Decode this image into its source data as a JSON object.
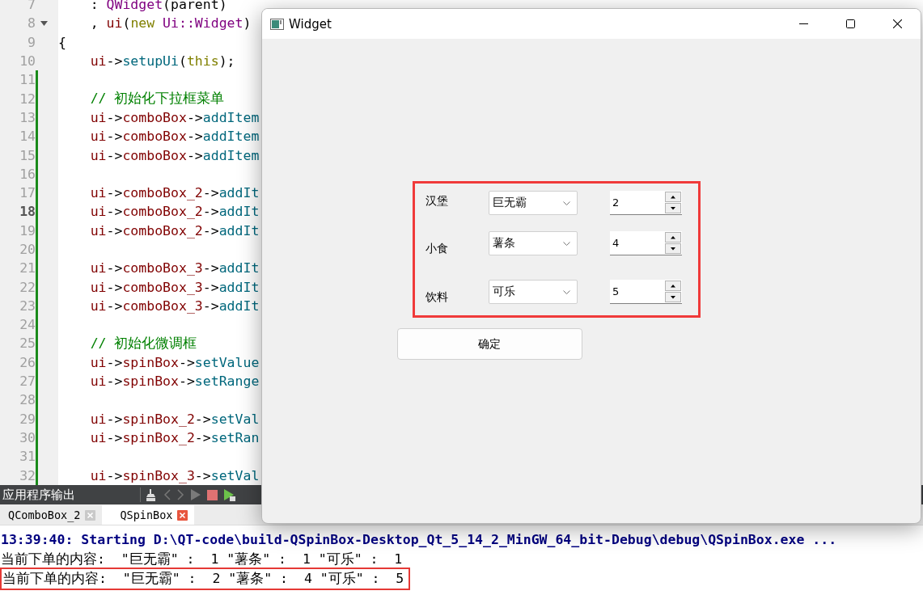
{
  "editor": {
    "lines": [
      {
        "number": "7",
        "indented": true,
        "changed": false,
        "current": false,
        "fold": false,
        "tokens": [
          {
            "kind": "plain",
            "text": ": "
          },
          {
            "kind": "type",
            "text": "QWidget"
          },
          {
            "kind": "plain",
            "text": "(parent)"
          }
        ]
      },
      {
        "number": "8",
        "indented": true,
        "changed": false,
        "current": false,
        "fold": true,
        "tokens": [
          {
            "kind": "plain",
            "text": ", "
          },
          {
            "kind": "member",
            "text": "ui"
          },
          {
            "kind": "plain",
            "text": "("
          },
          {
            "kind": "keyword",
            "text": "new"
          },
          {
            "kind": "type",
            "text": " Ui::Widget"
          },
          {
            "kind": "plain",
            "text": ")"
          }
        ]
      },
      {
        "number": "9",
        "indented": false,
        "changed": false,
        "current": false,
        "fold": false,
        "tokens": [
          {
            "kind": "plain",
            "text": "{"
          }
        ]
      },
      {
        "number": "10",
        "indented": true,
        "changed": false,
        "current": false,
        "fold": false,
        "tokens": [
          {
            "kind": "member",
            "text": "ui"
          },
          {
            "kind": "plain",
            "text": "->"
          },
          {
            "kind": "func",
            "text": "setupUi"
          },
          {
            "kind": "plain",
            "text": "("
          },
          {
            "kind": "keyword",
            "text": "this"
          },
          {
            "kind": "plain",
            "text": ");"
          }
        ]
      },
      {
        "number": "11",
        "changed": true,
        "current": false,
        "fold": false
      },
      {
        "number": "12",
        "indented": true,
        "changed": true,
        "current": false,
        "fold": false,
        "tokens": [
          {
            "kind": "comment",
            "text": "// 初始化下拉框菜单"
          }
        ]
      },
      {
        "number": "13",
        "indented": true,
        "changed": true,
        "current": false,
        "fold": false,
        "tokens": [
          {
            "kind": "member",
            "text": "ui"
          },
          {
            "kind": "plain",
            "text": "->"
          },
          {
            "kind": "member",
            "text": "comboBox"
          },
          {
            "kind": "plain",
            "text": "->"
          },
          {
            "kind": "func",
            "text": "addItem"
          }
        ]
      },
      {
        "number": "14",
        "indented": true,
        "changed": true,
        "current": false,
        "fold": false,
        "tokens": [
          {
            "kind": "member",
            "text": "ui"
          },
          {
            "kind": "plain",
            "text": "->"
          },
          {
            "kind": "member",
            "text": "comboBox"
          },
          {
            "kind": "plain",
            "text": "->"
          },
          {
            "kind": "func",
            "text": "addItem"
          }
        ]
      },
      {
        "number": "15",
        "indented": true,
        "changed": true,
        "current": false,
        "fold": false,
        "tokens": [
          {
            "kind": "member",
            "text": "ui"
          },
          {
            "kind": "plain",
            "text": "->"
          },
          {
            "kind": "member",
            "text": "comboBox"
          },
          {
            "kind": "plain",
            "text": "->"
          },
          {
            "kind": "func",
            "text": "addItem"
          }
        ]
      },
      {
        "number": "16",
        "changed": true,
        "current": false,
        "fold": false
      },
      {
        "number": "17",
        "indented": true,
        "changed": true,
        "current": false,
        "fold": false,
        "tokens": [
          {
            "kind": "member",
            "text": "ui"
          },
          {
            "kind": "plain",
            "text": "->"
          },
          {
            "kind": "member",
            "text": "comboBox_2"
          },
          {
            "kind": "plain",
            "text": "->"
          },
          {
            "kind": "func",
            "text": "addIt"
          }
        ]
      },
      {
        "number": "18",
        "indented": true,
        "changed": true,
        "current": true,
        "fold": false,
        "tokens": [
          {
            "kind": "member",
            "text": "ui"
          },
          {
            "kind": "plain",
            "text": "->"
          },
          {
            "kind": "member",
            "text": "comboBox_2"
          },
          {
            "kind": "plain",
            "text": "->"
          },
          {
            "kind": "func",
            "text": "addIt"
          }
        ]
      },
      {
        "number": "19",
        "indented": true,
        "changed": true,
        "current": false,
        "fold": false,
        "tokens": [
          {
            "kind": "member",
            "text": "ui"
          },
          {
            "kind": "plain",
            "text": "->"
          },
          {
            "kind": "member",
            "text": "comboBox_2"
          },
          {
            "kind": "plain",
            "text": "->"
          },
          {
            "kind": "func",
            "text": "addIt"
          }
        ]
      },
      {
        "number": "20",
        "changed": true,
        "current": false,
        "fold": false
      },
      {
        "number": "21",
        "indented": true,
        "changed": true,
        "current": false,
        "fold": false,
        "tokens": [
          {
            "kind": "member",
            "text": "ui"
          },
          {
            "kind": "plain",
            "text": "->"
          },
          {
            "kind": "member",
            "text": "comboBox_3"
          },
          {
            "kind": "plain",
            "text": "->"
          },
          {
            "kind": "func",
            "text": "addIt"
          }
        ]
      },
      {
        "number": "22",
        "indented": true,
        "changed": true,
        "current": false,
        "fold": false,
        "tokens": [
          {
            "kind": "member",
            "text": "ui"
          },
          {
            "kind": "plain",
            "text": "->"
          },
          {
            "kind": "member",
            "text": "comboBox_3"
          },
          {
            "kind": "plain",
            "text": "->"
          },
          {
            "kind": "func",
            "text": "addIt"
          }
        ]
      },
      {
        "number": "23",
        "indented": true,
        "changed": true,
        "current": false,
        "fold": false,
        "tokens": [
          {
            "kind": "member",
            "text": "ui"
          },
          {
            "kind": "plain",
            "text": "->"
          },
          {
            "kind": "member",
            "text": "comboBox_3"
          },
          {
            "kind": "plain",
            "text": "->"
          },
          {
            "kind": "func",
            "text": "addIt"
          }
        ]
      },
      {
        "number": "24",
        "changed": true,
        "current": false,
        "fold": false
      },
      {
        "number": "25",
        "indented": true,
        "changed": true,
        "current": false,
        "fold": false,
        "tokens": [
          {
            "kind": "comment",
            "text": "// 初始化微调框"
          }
        ]
      },
      {
        "number": "26",
        "indented": true,
        "changed": true,
        "current": false,
        "fold": false,
        "tokens": [
          {
            "kind": "member",
            "text": "ui"
          },
          {
            "kind": "plain",
            "text": "->"
          },
          {
            "kind": "member",
            "text": "spinBox"
          },
          {
            "kind": "plain",
            "text": "->"
          },
          {
            "kind": "func",
            "text": "setValue"
          }
        ]
      },
      {
        "number": "27",
        "indented": true,
        "changed": true,
        "current": false,
        "fold": false,
        "tokens": [
          {
            "kind": "member",
            "text": "ui"
          },
          {
            "kind": "plain",
            "text": "->"
          },
          {
            "kind": "member",
            "text": "spinBox"
          },
          {
            "kind": "plain",
            "text": "->"
          },
          {
            "kind": "func",
            "text": "setRange"
          }
        ]
      },
      {
        "number": "28",
        "changed": true,
        "current": false,
        "fold": false
      },
      {
        "number": "29",
        "indented": true,
        "changed": true,
        "current": false,
        "fold": false,
        "tokens": [
          {
            "kind": "member",
            "text": "ui"
          },
          {
            "kind": "plain",
            "text": "->"
          },
          {
            "kind": "member",
            "text": "spinBox_2"
          },
          {
            "kind": "plain",
            "text": "->"
          },
          {
            "kind": "func",
            "text": "setVal"
          }
        ]
      },
      {
        "number": "30",
        "indented": true,
        "changed": true,
        "current": false,
        "fold": false,
        "tokens": [
          {
            "kind": "member",
            "text": "ui"
          },
          {
            "kind": "plain",
            "text": "->"
          },
          {
            "kind": "member",
            "text": "spinBox_2"
          },
          {
            "kind": "plain",
            "text": "->"
          },
          {
            "kind": "func",
            "text": "setRan"
          }
        ]
      },
      {
        "number": "31",
        "changed": true,
        "current": false,
        "fold": false
      },
      {
        "number": "32",
        "indented": true,
        "changed": true,
        "current": false,
        "fold": false,
        "tokens": [
          {
            "kind": "member",
            "text": "ui"
          },
          {
            "kind": "plain",
            "text": "->"
          },
          {
            "kind": "member",
            "text": "spinBox_3"
          },
          {
            "kind": "plain",
            "text": "->"
          },
          {
            "kind": "func",
            "text": "setVal"
          }
        ]
      }
    ]
  },
  "output_pane": {
    "title": "应用程序输出",
    "tabs": [
      {
        "label": "QComboBox_2",
        "selected": false
      },
      {
        "label": "QSpinBox",
        "selected": true
      }
    ],
    "lines": [
      {
        "kind": "system",
        "text": "13:39:40: Starting D:\\QT-code\\build-QSpinBox-Desktop_Qt_5_14_2_MinGW_64_bit-Debug\\debug\\QSpinBox.exe ..."
      },
      {
        "kind": "stdout",
        "text": "当前下单的内容:  \"巨无霸\" :  1 \"薯条\" :  1 \"可乐\" :  1"
      },
      {
        "kind": "stdout",
        "text": "当前下单的内容:  \"巨无霸\" :  2 \"薯条\" :  4 \"可乐\" :  5"
      }
    ]
  },
  "widget_window": {
    "title": "Widget",
    "rows": [
      {
        "label": "汉堡",
        "choice": "巨无霸",
        "quantity": "2"
      },
      {
        "label": "小食",
        "choice": "薯条",
        "quantity": "4"
      },
      {
        "label": "饮料",
        "choice": "可乐",
        "quantity": "5"
      }
    ],
    "button": "确定"
  }
}
